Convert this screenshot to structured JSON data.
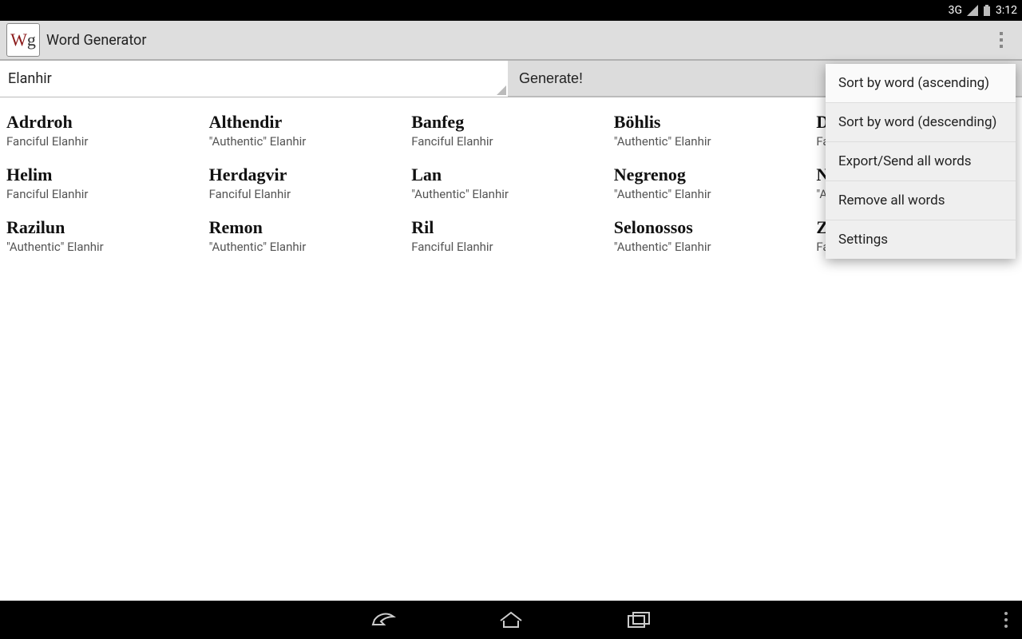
{
  "status": {
    "time": "3:12",
    "network": "3G"
  },
  "app": {
    "icon_text_w": "W",
    "icon_text_g": "g",
    "title": "Word Generator"
  },
  "spinner": {
    "selected": "Elanhir"
  },
  "generate_btn": "Generate!",
  "words": [
    {
      "word": "Adrdroh",
      "sub": "Fanciful Elanhir"
    },
    {
      "word": "Althendir",
      "sub": "\"Authentic\" Elanhir"
    },
    {
      "word": "Banfeg",
      "sub": "Fanciful Elanhir"
    },
    {
      "word": "Böhlis",
      "sub": "\"Authentic\" Elanhir"
    },
    {
      "word": "Dirdibdrur",
      "sub": "Fanciful Elanhir"
    },
    {
      "word": "Helim",
      "sub": "Fanciful Elanhir"
    },
    {
      "word": "Herdagvir",
      "sub": "Fanciful Elanhir"
    },
    {
      "word": "Lan",
      "sub": "\"Authentic\" Elanhir"
    },
    {
      "word": "Negrenog",
      "sub": "\"Authentic\" Elanhir"
    },
    {
      "word": "Nurak",
      "sub": "\"Authentic\" Elanhir"
    },
    {
      "word": "Razilun",
      "sub": "\"Authentic\" Elanhir"
    },
    {
      "word": "Remon",
      "sub": "\"Authentic\" Elanhir"
    },
    {
      "word": "Ril",
      "sub": "Fanciful Elanhir"
    },
    {
      "word": "Selonossos",
      "sub": "\"Authentic\" Elanhir"
    },
    {
      "word": "Zirnna",
      "sub": "Fanciful Elanhir"
    }
  ],
  "menu": [
    "Sort by word (ascending)",
    "Sort by word (descending)",
    "Export/Send all words",
    "Remove all words",
    "Settings"
  ]
}
